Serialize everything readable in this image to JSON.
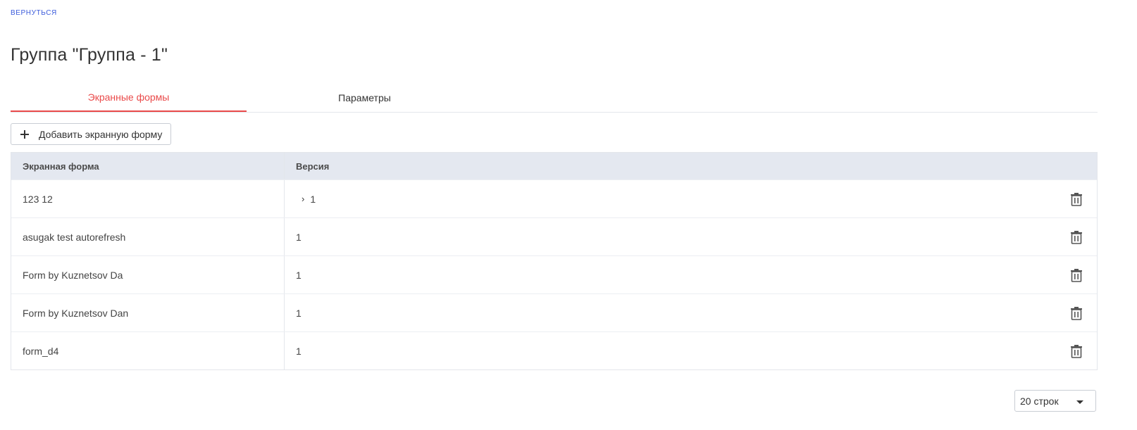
{
  "nav": {
    "back_label": "ВЕРНУТЬСЯ"
  },
  "page": {
    "title": "Группа \"Группа - 1\""
  },
  "tabs": [
    {
      "label": "Экранные формы",
      "active": true
    },
    {
      "label": "Параметры",
      "active": false
    }
  ],
  "toolbar": {
    "add_label": "Добавить экранную форму",
    "add_icon": "plus-icon"
  },
  "table": {
    "columns": [
      "Экранная форма",
      "Версия"
    ],
    "rows": [
      {
        "form": "123 12",
        "version": "1",
        "expandable": true
      },
      {
        "form": "asugak test autorefresh",
        "version": "1",
        "expandable": false
      },
      {
        "form": "Form by Kuznetsov Da",
        "version": "1",
        "expandable": false
      },
      {
        "form": "Form by Kuznetsov Dan",
        "version": "1",
        "expandable": false
      },
      {
        "form": "form_d4",
        "version": "1",
        "expandable": false
      }
    ],
    "row_action_icon": "trash-icon",
    "expand_icon": "chevron-right-icon"
  },
  "pagination": {
    "rows_per_page": "20 строк"
  },
  "colors": {
    "accent": "#ea4a4a",
    "link": "#3b5bdb",
    "header_bg": "#e4e8f0"
  }
}
